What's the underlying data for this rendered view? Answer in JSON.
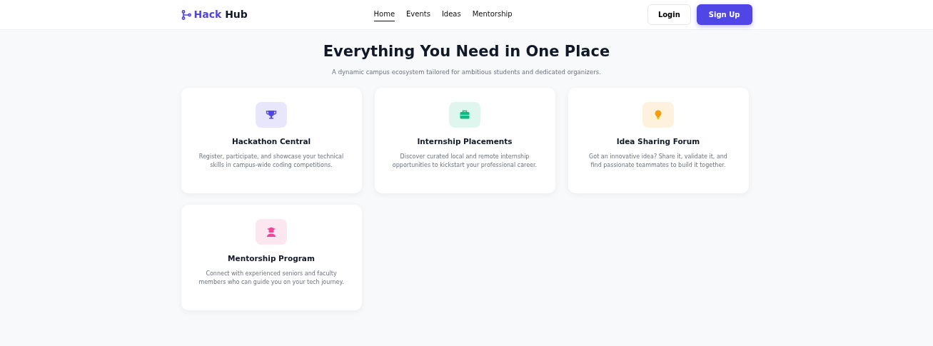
{
  "brand": {
    "part_1": "Hack",
    "part_2": "Hub"
  },
  "nav": [
    {
      "label": "Home",
      "selected": true
    },
    {
      "label": "Events",
      "selected": false
    },
    {
      "label": "Ideas",
      "selected": false
    },
    {
      "label": "Mentorship",
      "selected": false
    }
  ],
  "actions": [
    {
      "label": "Login",
      "kind": "outline"
    },
    {
      "label": "Sign Up",
      "kind": "primary"
    }
  ],
  "section": {
    "title": "Everything You Need in One Place",
    "subtitle": "A dynamic campus ecosystem tailored for ambitious students and dedicated organizers."
  },
  "features": [
    {
      "kind": "trophy",
      "color": "#4f46e5",
      "title": "Hackathon Central",
      "text": "Register, participate, and showcase your technical skills in campus-wide coding competitions."
    },
    {
      "kind": "briefcase",
      "color": "#10b981",
      "title": "Internship Placements",
      "text": "Discover curated local and remote internship opportunities to kickstart your professional career."
    },
    {
      "kind": "bulb",
      "color": "#f59e0b",
      "title": "Idea Sharing Forum",
      "text": "Got an innovative idea? Share it, validate it, and find passionate teammates to build it together."
    },
    {
      "kind": "graduate",
      "color": "#ec4899",
      "title": "Mentorship Program",
      "text": "Connect with experienced seniors and faculty members who can guide you on your tech journey."
    }
  ]
}
